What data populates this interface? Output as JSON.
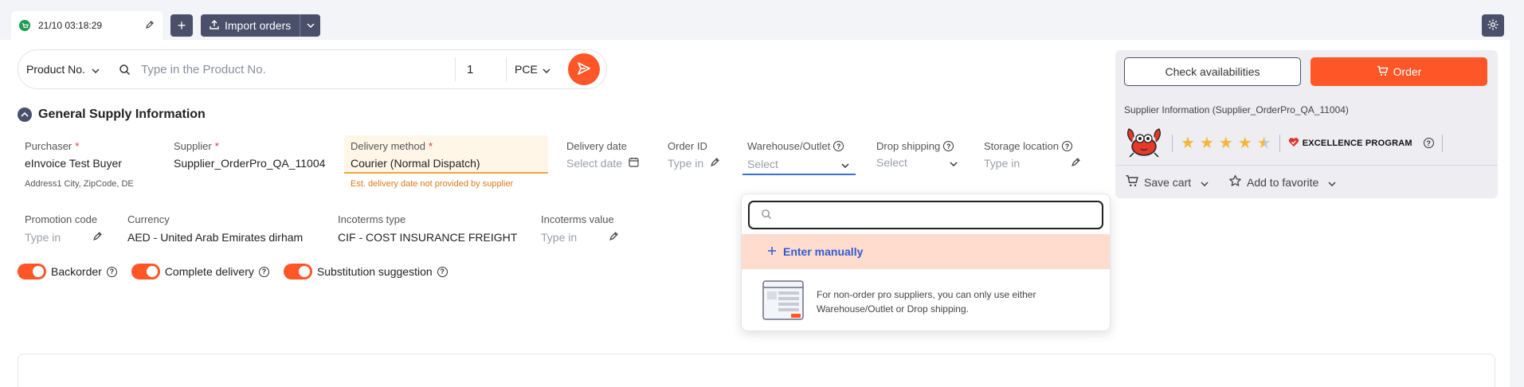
{
  "session": {
    "time": "21/10 03:18:29"
  },
  "toolbar": {
    "add_label": "+",
    "import_label": "Import orders"
  },
  "search": {
    "product_field": "Product No.",
    "placeholder": "Type in the Product No.",
    "quantity": "1",
    "unit": "PCE"
  },
  "section": {
    "title": "General Supply Information"
  },
  "fields": {
    "purchaser": {
      "label": "Purchaser",
      "required": "*",
      "value": "eInvoice Test Buyer",
      "sub": "Address1 City, ZipCode, DE"
    },
    "supplier": {
      "label": "Supplier",
      "required": "*",
      "value": "Supplier_OrderPro_QA_11004"
    },
    "delivery_method": {
      "label": "Delivery method",
      "required": "*",
      "value": "Courier (Normal Dispatch)",
      "warning": "Est. delivery date not provided by supplier"
    },
    "delivery_date": {
      "label": "Delivery date",
      "placeholder": "Select date"
    },
    "order_id": {
      "label": "Order ID",
      "placeholder": "Type in"
    },
    "warehouse": {
      "label": "Warehouse/Outlet",
      "placeholder": "Select"
    },
    "drop_shipping": {
      "label": "Drop shipping",
      "placeholder": "Select"
    },
    "storage_location": {
      "label": "Storage location",
      "placeholder": "Type in"
    },
    "promotion_code": {
      "label": "Promotion code",
      "placeholder": "Type in"
    },
    "currency": {
      "label": "Currency",
      "value": "AED - United Arab Emirates dirham"
    },
    "incoterms_type": {
      "label": "Incoterms type",
      "value": "CIF - COST INSURANCE FREIGHT"
    },
    "incoterms_value": {
      "label": "Incoterms value",
      "placeholder": "Type in"
    }
  },
  "toggles": [
    {
      "label": "Backorder",
      "on": true
    },
    {
      "label": "Complete delivery",
      "on": true
    },
    {
      "label": "Substitution suggestion",
      "on": true
    }
  ],
  "dropdown": {
    "enter_manually": "Enter manually",
    "info_text": "For non-order pro suppliers, you can only use either Warehouse/Outlet or Drop shipping."
  },
  "side": {
    "check_label": "Check availabilities",
    "order_label": "Order",
    "supplier_info": "Supplier Information (Supplier_OrderPro_QA_11004)",
    "rating": 4.5,
    "excellence_label": "EXCELLENCE PROGRAM",
    "save_cart": "Save cart",
    "add_favorite": "Add to favorite"
  },
  "colors": {
    "accent": "#ff5627",
    "dark": "#4a4f6a",
    "link": "#2f5bd3",
    "warn": "#e07a1d"
  }
}
